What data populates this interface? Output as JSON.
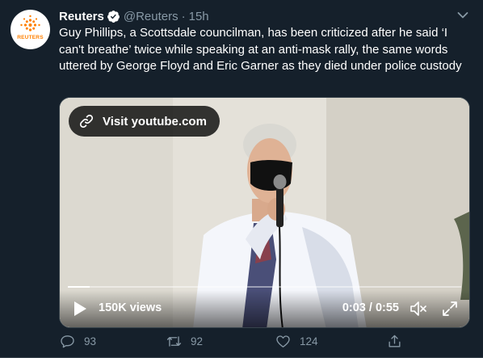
{
  "account": {
    "name": "Reuters",
    "handle": "@Reuters",
    "separator": "·",
    "time": "15h",
    "avatar_wordmark": "REUTERS"
  },
  "tweet": {
    "text": "Guy Phillips, a Scottsdale councilman, has been criticized after he said ‘I can't breathe’ twice while speaking at an anti-mask rally, the same words uttered by George Floyd and Eric Garner as they died under police custody"
  },
  "media": {
    "link_label": "Visit youtube.com",
    "views": "150K views",
    "elapsed": "0:03",
    "duration": "0:55",
    "time_separator": " / ",
    "progress_fraction": 0.055
  },
  "actions": {
    "reply_count": "93",
    "retweet_count": "92",
    "like_count": "124"
  },
  "icons": {
    "verified": "verified-badge-icon",
    "caret": "chevron-down-icon",
    "link": "link-icon",
    "play": "play-icon",
    "mute": "mute-icon",
    "fullscreen": "fullscreen-icon",
    "reply": "reply-icon",
    "retweet": "retweet-icon",
    "like": "heart-icon",
    "share": "share-icon"
  },
  "colors": {
    "background": "#15202b",
    "secondary_text": "#8899a6",
    "verified": "#ffffff",
    "brand_orange": "#ff8000"
  }
}
